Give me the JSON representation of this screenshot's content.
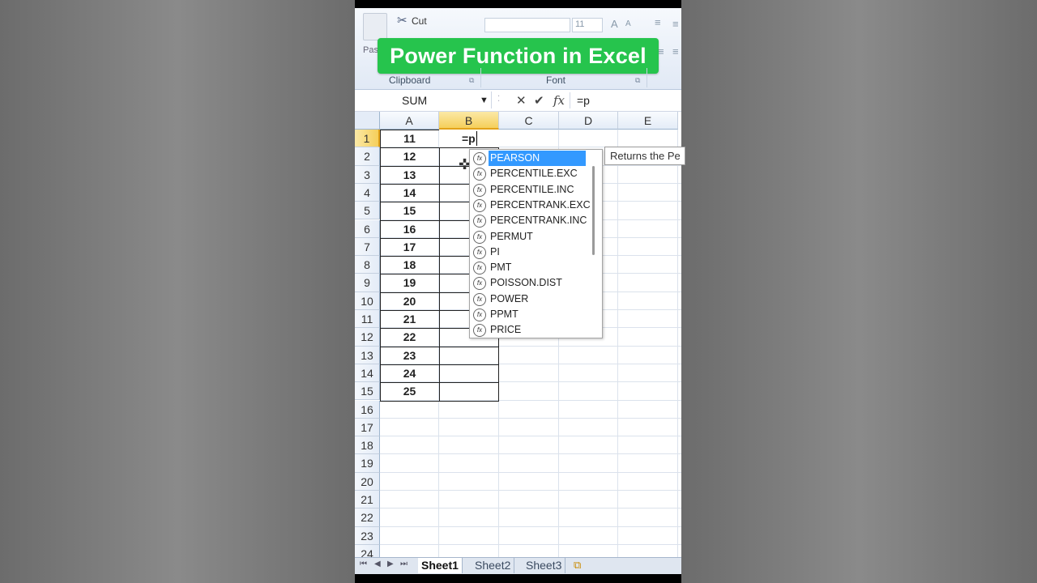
{
  "banner": {
    "title": "Power Function in Excel"
  },
  "ribbon": {
    "cut_label": "Cut",
    "paste_label": "Pas",
    "font_size": "11",
    "clipboard_label": "Clipboard",
    "font_label": "Font"
  },
  "formula_bar": {
    "name_box": "SUM",
    "formula": "=p",
    "cancel_symbol": "✕",
    "enter_symbol": "✔",
    "fx_symbol": "fx"
  },
  "columns": [
    "A",
    "B",
    "C",
    "D",
    "E"
  ],
  "rows": [
    "1",
    "2",
    "3",
    "4",
    "5",
    "6",
    "7",
    "8",
    "9",
    "10",
    "11",
    "12",
    "13",
    "14",
    "15",
    "16",
    "17",
    "18",
    "19",
    "20",
    "21",
    "22",
    "23",
    "24"
  ],
  "column_a_values": [
    "11",
    "12",
    "13",
    "14",
    "15",
    "16",
    "17",
    "18",
    "19",
    "20",
    "21",
    "22",
    "23",
    "24",
    "25"
  ],
  "active_cell": {
    "text": "=p"
  },
  "autocomplete": {
    "items": [
      "PEARSON",
      "PERCENTILE.EXC",
      "PERCENTILE.INC",
      "PERCENTRANK.EXC",
      "PERCENTRANK.INC",
      "PERMUT",
      "PI",
      "PMT",
      "POISSON.DIST",
      "POWER",
      "PPMT",
      "PRICE"
    ],
    "highlighted": "PEARSON",
    "icon": "function-icon"
  },
  "tooltip": {
    "text": "Returns the Pe"
  },
  "sheets": {
    "tabs": [
      "Sheet1",
      "Sheet2",
      "Sheet3"
    ],
    "active": "Sheet1"
  },
  "colors": {
    "banner": "#26c44d",
    "selection": "#3399ff",
    "header_selected": "#f5cf5b"
  }
}
